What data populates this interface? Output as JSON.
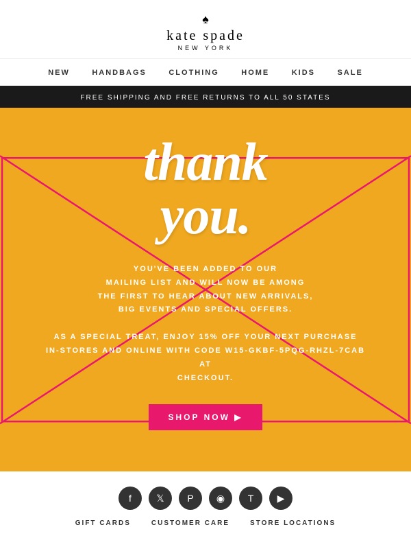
{
  "header": {
    "spade_symbol": "♠",
    "brand_name": "kate spade",
    "brand_location": "NEW YORK"
  },
  "nav": {
    "items": [
      {
        "label": "NEW",
        "href": "#"
      },
      {
        "label": "HANDBAGS",
        "href": "#"
      },
      {
        "label": "CLOTHING",
        "href": "#"
      },
      {
        "label": "HOME",
        "href": "#"
      },
      {
        "label": "KIDS",
        "href": "#"
      },
      {
        "label": "SALE",
        "href": "#"
      }
    ]
  },
  "banner": {
    "text": "FREE SHIPPING AND FREE RETURNS TO ALL 50 STATES"
  },
  "main": {
    "thank_you_line1": "thank",
    "thank_you_line2": "you.",
    "mailing_text": "YOU'VE BEEN ADDED TO OUR\nMAILING LIST AND WILL NOW BE AMONG\nTHE FIRST TO HEAR ABOUT NEW ARRIVALS,\nBIG EVENTS AND SPECIAL OFFERS.",
    "promo_text": "AS A SPECIAL TREAT, ENJOY 15% OFF YOUR NEXT PURCHASE\nIN-STORES AND ONLINE WITH CODE W15-GKBF-5PQG-RHZL-7CAB AT\nCHECKOUT.",
    "shop_button": "SHOP NOW ▶"
  },
  "footer": {
    "social": [
      {
        "name": "facebook",
        "symbol": "f"
      },
      {
        "name": "twitter",
        "symbol": "t"
      },
      {
        "name": "pinterest",
        "symbol": "p"
      },
      {
        "name": "instagram",
        "symbol": "📷"
      },
      {
        "name": "tumblr",
        "symbol": "T"
      },
      {
        "name": "youtube",
        "symbol": "▶"
      }
    ],
    "links": [
      {
        "label": "GIFT CARDS"
      },
      {
        "label": "CUSTOMER CARE"
      },
      {
        "label": "STORE LOCATIONS"
      }
    ]
  }
}
